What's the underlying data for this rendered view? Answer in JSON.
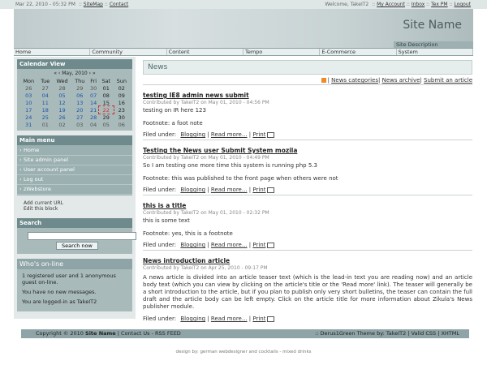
{
  "topbar": {
    "datetime": "Mar 22, 2010 - 05:32 PM",
    "left_links": [
      "SiteMap",
      "Contact"
    ],
    "right_links": [
      "Welcome, TakeIT2",
      "My Account",
      "Inbox",
      "Tex PM",
      "Logout"
    ]
  },
  "header": {
    "site_name": "Site Name",
    "site_description": "Site Description"
  },
  "nav": [
    "Home",
    "Community",
    "Content",
    "Tempo",
    "E-Commerce",
    "System"
  ],
  "calendar": {
    "title": "Calendar View",
    "month": "May, 2010",
    "nav_prev": "« ‹",
    "nav_next": "› »",
    "weekdays": [
      "Mon",
      "Tue",
      "Wed",
      "Thu",
      "Fri",
      "Sat",
      "Sun"
    ],
    "weeks": [
      [
        "26",
        "27",
        "28",
        "29",
        "30",
        "01",
        "02"
      ],
      [
        "03",
        "04",
        "05",
        "06",
        "07",
        "08",
        "09"
      ],
      [
        "10",
        "11",
        "12",
        "13",
        "14",
        "15",
        "16"
      ],
      [
        "17",
        "18",
        "19",
        "20",
        "21",
        "22",
        "23"
      ],
      [
        "24",
        "25",
        "26",
        "27",
        "28",
        "29",
        "30"
      ],
      [
        "31",
        "01",
        "02",
        "03",
        "04",
        "05",
        "06"
      ]
    ]
  },
  "mainmenu": {
    "title": "Main menu",
    "items": [
      "Home",
      "Site admin panel",
      "User account panel",
      "Log out",
      "zWebstore"
    ],
    "extra": [
      "Add current URL",
      "Edit this block"
    ]
  },
  "search": {
    "title": "Search",
    "button": "Search now",
    "value": ""
  },
  "online": {
    "title": "Who's on-line",
    "lines": [
      "1 registered user and 1 anonymous guest on-line.",
      "You have no new messages.",
      "You are logged-in as TakeIT2"
    ]
  },
  "news": {
    "title": "News",
    "toolbar": [
      "News categories",
      "News archive",
      "Submit an article"
    ],
    "articles": [
      {
        "title": "testing IE8 admin news submit",
        "meta": "Contributed by TakeIT2 on May 01, 2010 - 04:56 PM",
        "text": "testing on IR here 123",
        "footnote": "Footnote: a foot note",
        "filed": "Filed under:",
        "category": "Blogging",
        "more": "Read more...",
        "print": "Print"
      },
      {
        "title": "Testing the News user Submit System mozila",
        "meta": "Contributed by TakeIT2 on May 01, 2010 - 04:49 PM",
        "text": "So I am testing one more time this system is running php 5.3",
        "footnote": "Footnote: this was published to the front page when others were not",
        "filed": "Filed under:",
        "category": "Blogging",
        "more": "Read more...",
        "print": "Print"
      },
      {
        "title": "this is a title",
        "meta": "Contributed by TakeIT2 on May 01, 2010 - 02:32 PM",
        "text": "this is some text",
        "footnote": "Footnote: yes, this is a footnote",
        "filed": "Filed under:",
        "category": "Blogging",
        "more": "Read more...",
        "print": "Print"
      },
      {
        "title": "News introduction article",
        "meta": "Contributed by TakeIT2 on Apr 25, 2010 - 09:17 PM",
        "text": "A news article is divided into an article teaser text (which is the lead-in text you are reading now) and an article body text (which you can view by clicking on the article's title or the 'Read more' link). The teaser will generally be a short introduction to the article, but if you plan to publish only very short bulletins, the teaser can contain the full draft and the article body can be left empty. Click on the article title for more information about Zikula's News publisher module.",
        "footnote": "",
        "filed": "Filed under:",
        "category": "Blogging",
        "more": "Read more...",
        "print": "Print"
      }
    ]
  },
  "footer": {
    "left": "Copyright © 2010",
    "site_name": "Site Name",
    "links": "Contact Us - RSS FEED",
    "theme": ":: Derus1Green Theme by: TakeIT2",
    "valid": "Valid CSS | XHTML",
    "credit": "design by: german webdesigner and cocktails - mixed drinks"
  }
}
